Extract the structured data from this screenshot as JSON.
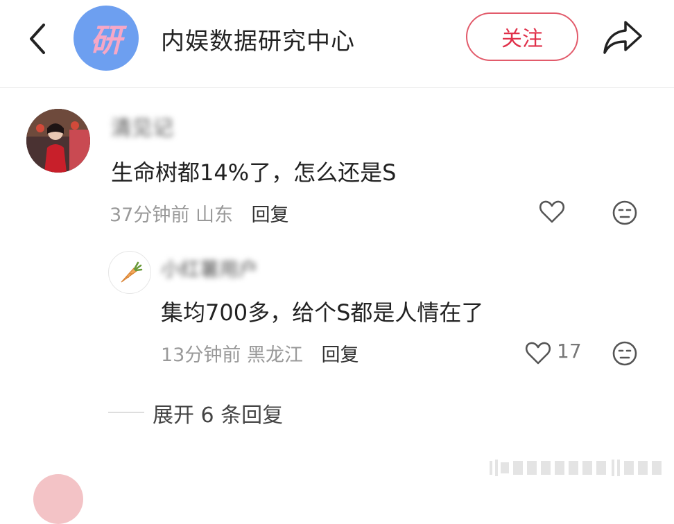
{
  "header": {
    "channel_avatar_text": "研",
    "channel_name": "内娱数据研究中心",
    "follow_label": "关注"
  },
  "comments": [
    {
      "username": "清见记",
      "text": "生命树都14%了，怎么还是S",
      "time": "37分钟前",
      "location": "山东",
      "reply_label": "回复"
    },
    {
      "username": "小红薯用户",
      "text": "集均700多，给个S都是人情在了",
      "time": "13分钟前",
      "location": "黑龙江",
      "reply_label": "回复",
      "like_count": "17"
    }
  ],
  "expand_label": "展开 6 条回复",
  "icons": {
    "back": "chevron-left-icon",
    "share": "share-arrow-icon",
    "like": "heart-outline-icon",
    "emoji": "neutral-face-icon"
  },
  "colors": {
    "accent": "#e0304a",
    "channel_avatar_bg": "#6d9ff0"
  }
}
